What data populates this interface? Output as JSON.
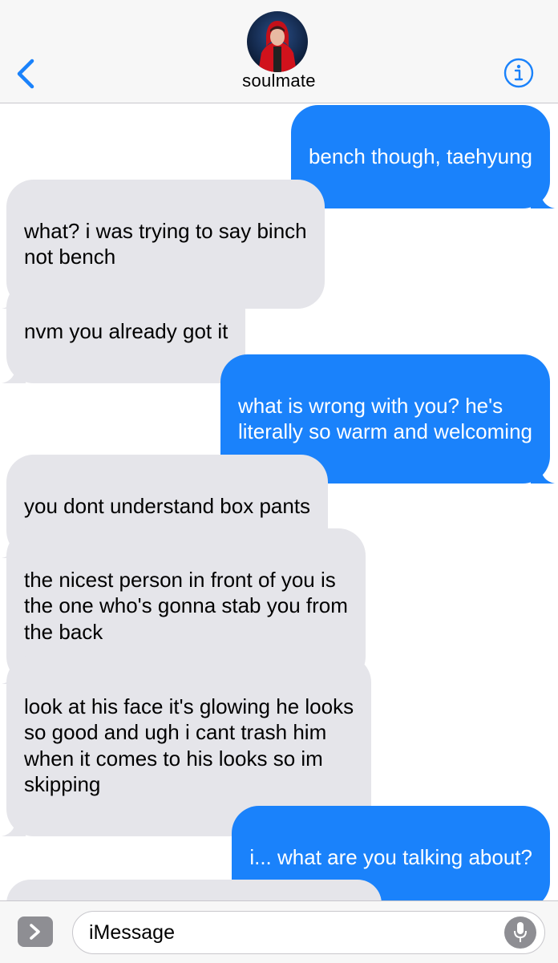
{
  "header": {
    "contact_name": "soulmate",
    "back_icon": "chevron-left-icon",
    "info_icon": "info-icon",
    "accent_color": "#1a82fb"
  },
  "messages": [
    {
      "from": "me",
      "text": "bench though, taehyung"
    },
    {
      "from": "them",
      "text": "what? i was trying to say binch\nnot bench"
    },
    {
      "from": "them",
      "text": "nvm you already got it"
    },
    {
      "from": "me",
      "text": "what is wrong with you? he's\nliterally so warm and welcoming"
    },
    {
      "from": "them",
      "text": "you dont understand box pants"
    },
    {
      "from": "them",
      "text": "the nicest person in front of you is\nthe one who's gonna stab you from\nthe back"
    },
    {
      "from": "them",
      "text": "look at his face it's glowing he looks\nso good and ugh i cant trash him\nwhen it comes to his looks so im\nskipping"
    },
    {
      "from": "me",
      "text": "i... what are you talking about?"
    }
  ],
  "input": {
    "placeholder": "iMessage",
    "apps_icon": "chevron-right-icon",
    "mic_icon": "microphone-icon"
  },
  "colors": {
    "incoming_bubble": "#e5e5ea",
    "outgoing_bubble": "#1a82fb"
  }
}
